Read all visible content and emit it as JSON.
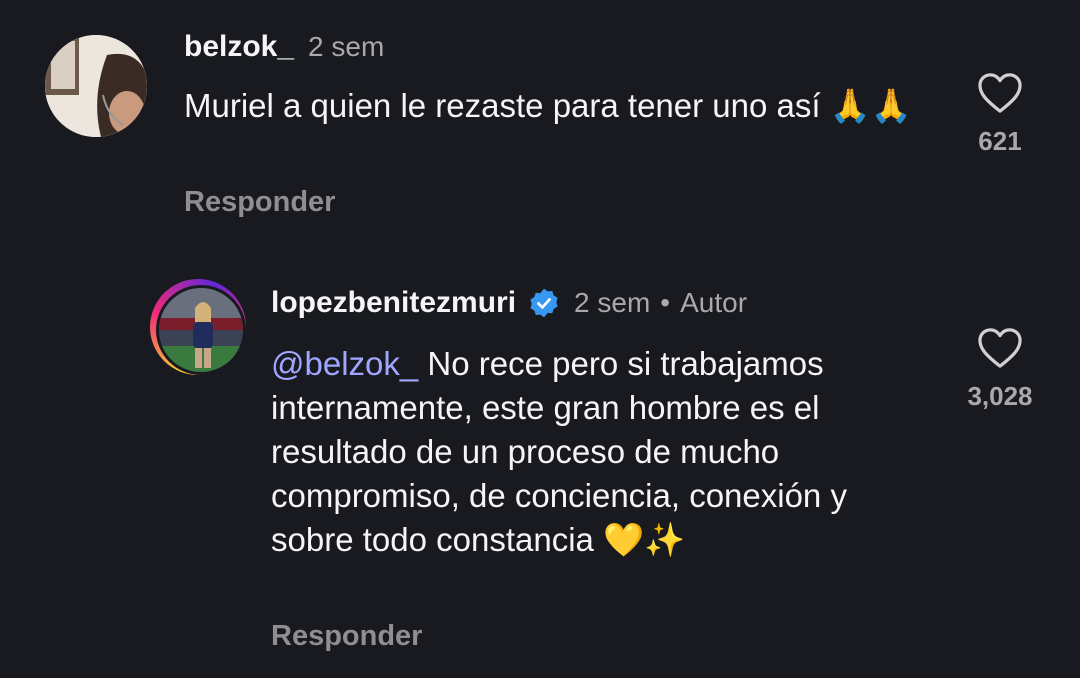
{
  "comments": [
    {
      "username": "belzok_",
      "time": "2 sem",
      "text": "Muriel a quien le rezaste para tener uno así 🙏🙏",
      "reply_label": "Responder",
      "likes": "621"
    },
    {
      "username": "lopezbenitezmuri",
      "verified": true,
      "time": "2 sem",
      "separator": "•",
      "author_label": "Autor",
      "mention": "@belzok_",
      "text": "No rece pero si trabajamos internamente, este gran hombre es el resultado de un proceso de mucho compromiso, de conciencia, conexión y sobre todo constancia 💛✨",
      "reply_label": "Responder",
      "likes": "3,028"
    }
  ],
  "icons": {
    "like": "heart-outline-icon",
    "verified": "verified-badge-icon"
  },
  "colors": {
    "background": "#181a1f",
    "mention": "#a0a6ff",
    "verified": "#3897f0",
    "muted": "#a8a8ad"
  }
}
